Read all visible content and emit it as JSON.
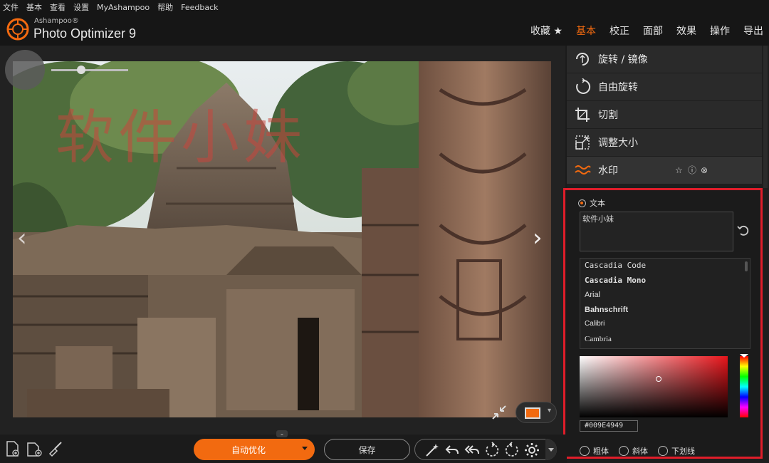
{
  "menu": {
    "items": [
      "文件",
      "基本",
      "查看",
      "设置",
      "MyAshampoo",
      "帮助",
      "Feedback"
    ]
  },
  "app": {
    "brand_small": "Ashampoo®",
    "title": "Photo Optimizer 9"
  },
  "topnav": {
    "items": [
      "收藏 ★",
      "基本",
      "校正",
      "面部",
      "效果",
      "操作",
      "导出"
    ],
    "active": "基本"
  },
  "stage": {
    "watermark_text": "软件小妹",
    "prev_icon": "chevron-left-icon",
    "next_icon": "chevron-right-icon"
  },
  "tools": {
    "items": [
      {
        "label": "旋转 / 镜像",
        "icon": "rotate-mirror-icon"
      },
      {
        "label": "自由旋转",
        "icon": "free-rotate-icon"
      },
      {
        "label": "切割",
        "icon": "crop-icon"
      },
      {
        "label": "调整大小",
        "icon": "resize-icon"
      },
      {
        "label": "水印",
        "icon": "watermark-icon"
      }
    ]
  },
  "watermark": {
    "mode_label": "文本",
    "text_value": "软件小妹",
    "fonts": [
      "Cascadia Code",
      "Cascadia Mono",
      "Arial",
      "Bahnschrift",
      "Calibri",
      "Cambria"
    ],
    "hex_value": "#009E4949",
    "styles": [
      "粗体",
      "斜体",
      "下划线"
    ]
  },
  "bottom": {
    "auto_label": "自动优化",
    "save_label": "保存"
  },
  "colors": {
    "accent": "#f26a10",
    "highlight_border": "#e01d2a",
    "picker_hue": "#e8151b"
  }
}
